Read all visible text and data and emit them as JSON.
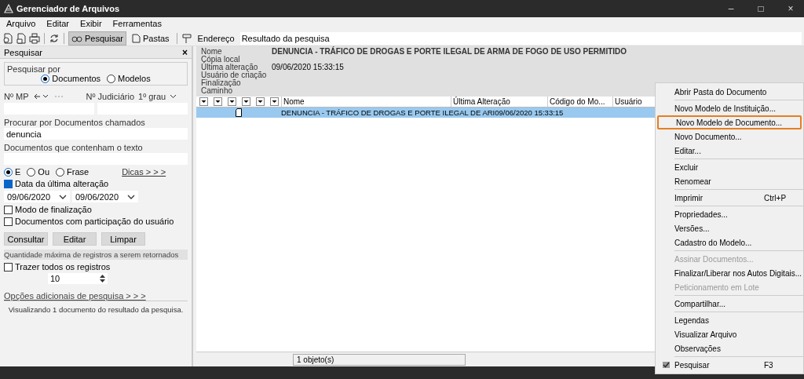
{
  "window": {
    "title": "Gerenciador de Arquivos",
    "controls": [
      "–",
      "□",
      "×"
    ]
  },
  "menu_bar": [
    "Arquivo",
    "Editar",
    "Exibir",
    "Ferramentas"
  ],
  "toolbar": {
    "buttons": [
      {
        "label": "Pesquisar",
        "selected": true
      },
      {
        "label": "Pastas",
        "selected": false
      }
    ],
    "address_label": "Endereço",
    "address_value": "Resultado da pesquisa"
  },
  "search_panel": {
    "title": "Pesquisar",
    "close": "×",
    "search_by": {
      "label": "Pesquisar por",
      "options": [
        {
          "label": "Documentos",
          "selected": true
        },
        {
          "label": "Modelos",
          "selected": false
        }
      ]
    },
    "mp_label": "Nº MP",
    "judicial_label": "Nº Judiciário",
    "judicial_grade": "1º grau",
    "name_label": "Procurar por Documentos chamados",
    "name_value": "denuncia",
    "text_label": "Documentos que contenham o texto",
    "text_modes": [
      {
        "label": "E",
        "selected": true
      },
      {
        "label": "Ou",
        "selected": false
      },
      {
        "label": "Frase",
        "selected": false
      }
    ],
    "tips_link": "Dicas > > >",
    "date_filter": {
      "label": "Data da última alteração",
      "checked": true,
      "from": "09/06/2020",
      "to": "09/06/2020"
    },
    "checkboxes": [
      {
        "label": "Modo de finalização",
        "checked": false
      },
      {
        "label": "Documentos com participação do usuário",
        "checked": false
      }
    ],
    "buttons": [
      "Consultar",
      "Editar",
      "Limpar"
    ],
    "max_section": "Quantidade máxima de registros a serem retornados",
    "bring_all": {
      "label": "Trazer todos os registros",
      "checked": false
    },
    "max_value": "10",
    "more_options": "Opções adicionais de pesquisa > > >",
    "summary": "Visualizando 1 documento do resultado da pesquisa."
  },
  "details": [
    {
      "label": "Nome",
      "value": "DENUNCIA - TRÁFICO DE DROGAS E PORTE ILEGAL DE ARMA DE FOGO DE USO PERMITIDO"
    },
    {
      "label": "Cópia local"
    },
    {
      "label": "Última alteração",
      "value": "09/06/2020 15:33:15"
    },
    {
      "label": "Usuário de criação"
    },
    {
      "label": "Finalização"
    },
    {
      "label": "Caminho"
    }
  ],
  "table": {
    "columns": [
      "Nome",
      "Última Alteração",
      "Código do Mo...",
      "Usuário"
    ],
    "rows": [
      {
        "name": "DENUNCIA - TRÁFICO DE DROGAS E PORTE ILEGAL DE ARI",
        "modified": "09/06/2020 15:33:15",
        "selected": true
      }
    ],
    "footer": "1 objeto(s)"
  },
  "context_menu": [
    {
      "kind": "item",
      "label": "Abrir Pasta do Documento",
      "disabled": false,
      "highlighted": false
    },
    {
      "kind": "separator"
    },
    {
      "kind": "item",
      "label": "Novo Modelo de Instituição...",
      "disabled": false,
      "highlighted": false
    },
    {
      "kind": "item",
      "label": "Novo Modelo de Documento...",
      "disabled": false,
      "highlighted": true
    },
    {
      "kind": "item",
      "label": "Novo Documento...",
      "disabled": false,
      "highlighted": false
    },
    {
      "kind": "item",
      "label": "Editar...",
      "disabled": false,
      "highlighted": false
    },
    {
      "kind": "separator"
    },
    {
      "kind": "item",
      "label": "Excluir",
      "disabled": false,
      "highlighted": false
    },
    {
      "kind": "item",
      "label": "Renomear",
      "disabled": false,
      "highlighted": false
    },
    {
      "kind": "separator"
    },
    {
      "kind": "item",
      "label": "Imprimir",
      "shortcut": "Ctrl+P",
      "disabled": false,
      "highlighted": false
    },
    {
      "kind": "separator"
    },
    {
      "kind": "item",
      "label": "Propriedades...",
      "disabled": false,
      "highlighted": false
    },
    {
      "kind": "item",
      "label": "Versões...",
      "disabled": false,
      "highlighted": false
    },
    {
      "kind": "item",
      "label": "Cadastro do Modelo...",
      "disabled": false,
      "highlighted": false
    },
    {
      "kind": "separator"
    },
    {
      "kind": "item",
      "label": "Assinar Documentos...",
      "disabled": true,
      "highlighted": false
    },
    {
      "kind": "item",
      "label": "Finalizar/Liberar nos Autos Digitais...",
      "disabled": false,
      "highlighted": false
    },
    {
      "kind": "item",
      "label": "Peticionamento em Lote",
      "disabled": true,
      "highlighted": false
    },
    {
      "kind": "separator"
    },
    {
      "kind": "item",
      "label": "Compartilhar...",
      "disabled": false,
      "highlighted": false
    },
    {
      "kind": "separator"
    },
    {
      "kind": "item",
      "label": "Legendas",
      "disabled": false,
      "highlighted": false
    },
    {
      "kind": "item",
      "label": "Visualizar Arquivo",
      "disabled": false,
      "highlighted": false
    },
    {
      "kind": "item",
      "label": "Observações",
      "disabled": false,
      "highlighted": false
    },
    {
      "kind": "separator"
    },
    {
      "kind": "item",
      "label": "Pesquisar",
      "shortcut": "F3",
      "checked": true,
      "disabled": false,
      "highlighted": false
    }
  ]
}
